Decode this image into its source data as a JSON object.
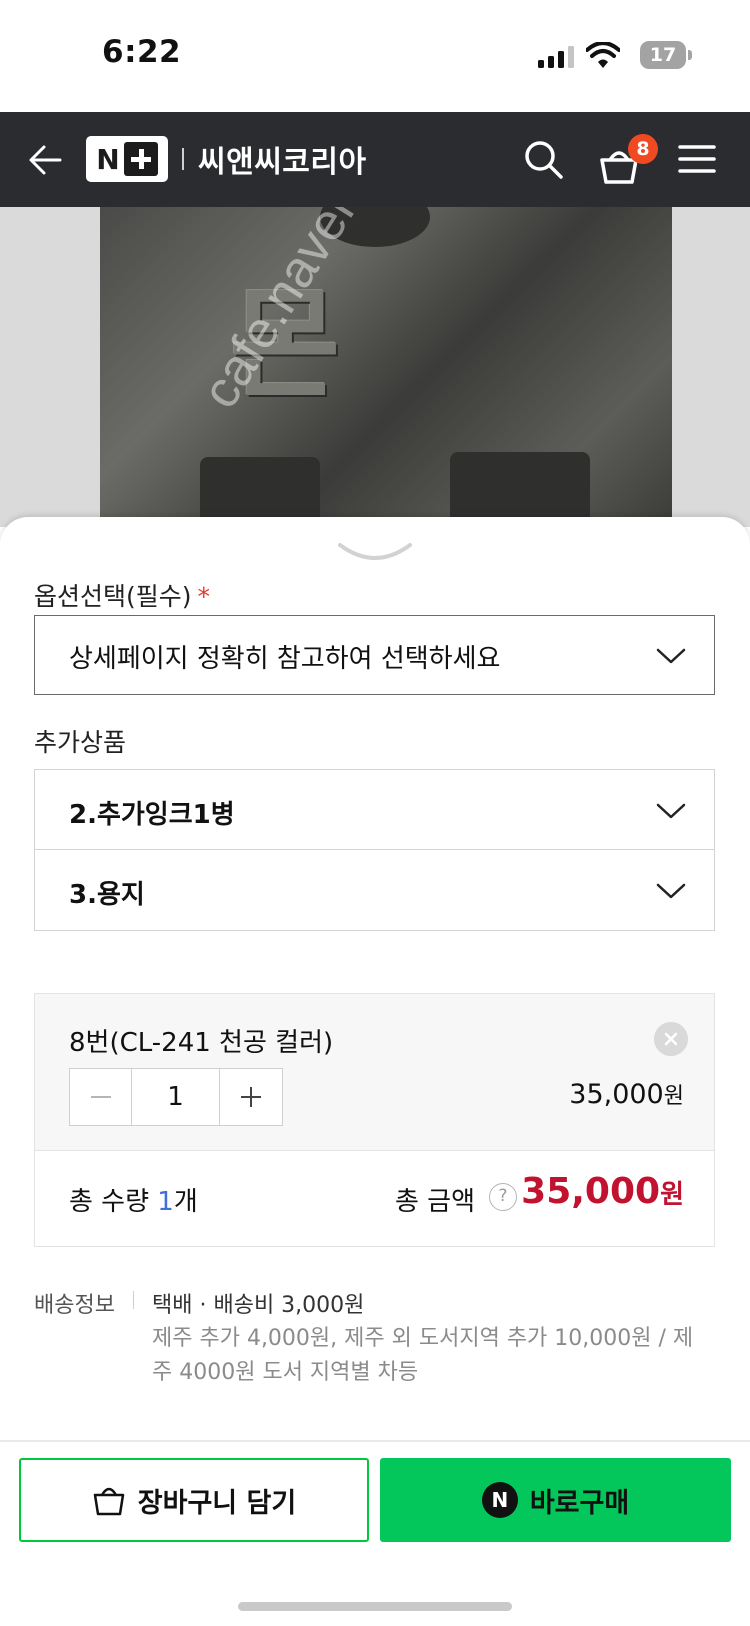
{
  "status_bar": {
    "time": "6:22",
    "battery": "17"
  },
  "header": {
    "brand_logo": "N+",
    "store_name": "씨앤씨코리아",
    "cart_count": "8"
  },
  "product_image": {
    "watermark": "cafe.naver.com/joonggonara"
  },
  "sheet": {
    "option_label": "옵션선택(필수)",
    "required_mark": "*",
    "option_placeholder": "상세페이지 정확히 참고하여 선택하세요",
    "addon_label": "추가상품",
    "addons": [
      {
        "label": "2.추가잉크1병"
      },
      {
        "label": "3.용지"
      }
    ],
    "selected_item": {
      "name": "8번(CL-241 천공 컬러)",
      "quantity": "1",
      "price": "35,000",
      "price_unit": "원"
    },
    "total": {
      "qty_prefix": "총 수량 ",
      "qty_value": "1",
      "qty_suffix": "개",
      "amount_label": "총 금액",
      "help": "?",
      "amount": "35,000",
      "amount_unit": "원"
    },
    "shipping": {
      "label": "배송정보",
      "main": "택배 · 배송비 3,000원",
      "extra": "제주 추가 4,000원, 제주 외 도서지역 추가 10,000원 / 제주 4000원 도서 지역별 차등"
    }
  },
  "actions": {
    "cart_label": "장바구니 담기",
    "buy_label": "바로구매",
    "npay_mark": "N"
  },
  "colors": {
    "accent_green": "#03c75a",
    "price_red": "#c1122f",
    "badge_orange": "#f04a23",
    "header_bg": "#2a2c2f"
  }
}
